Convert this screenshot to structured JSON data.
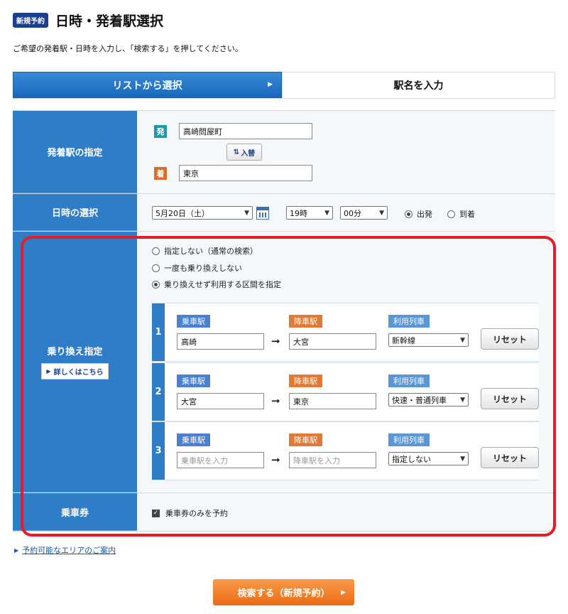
{
  "header": {
    "badge": "新規予約",
    "title": "日時・発着駅選択"
  },
  "subtitle": "ご希望の発着駅・日時を入力し、「検索する」を押してください。",
  "tabs": [
    {
      "label": "リストから選択",
      "active": true
    },
    {
      "label": "駅名を入力",
      "active": false
    }
  ],
  "stations": {
    "label": "発着駅の指定",
    "dep_tag": "発",
    "arr_tag": "着",
    "departure": "高崎問屋町",
    "arrival": "東京",
    "swap_label": "入替"
  },
  "datetime": {
    "label": "日時の選択",
    "date": "5月20日（土）",
    "hour": "19時",
    "minute": "00分",
    "options": [
      "出発",
      "到着"
    ],
    "selected": "出発"
  },
  "transfer": {
    "label": "乗り換え指定",
    "detail_label": "詳しくはこちら",
    "options": [
      "指定しない（通常の検索）",
      "一度も乗り換えしない",
      "乗り換えせず利用する区間を指定"
    ],
    "selected": 2,
    "board_label": "乗車駅",
    "alight_label": "降車駅",
    "train_label": "利用列車",
    "reset_label": "リセット",
    "segments": [
      {
        "num": "1",
        "board": "高崎",
        "alight": "大宮",
        "train": "新幹線"
      },
      {
        "num": "2",
        "board": "大宮",
        "alight": "東京",
        "train": "快速・普通列車"
      },
      {
        "num": "3",
        "board": "",
        "alight": "",
        "board_ph": "乗車駅を入力",
        "alight_ph": "降車駅を入力",
        "train": "指定しない"
      }
    ]
  },
  "ticket": {
    "label": "乗車券",
    "checkbox_label": "乗車券のみを予約",
    "checked": true
  },
  "area_link": "予約可能なエリアのご案内",
  "search_button": "検索する（新規予約）",
  "colors": {
    "highlight": "#e51d24",
    "primary": "#2f7dc7",
    "search": "#ec6b14"
  }
}
